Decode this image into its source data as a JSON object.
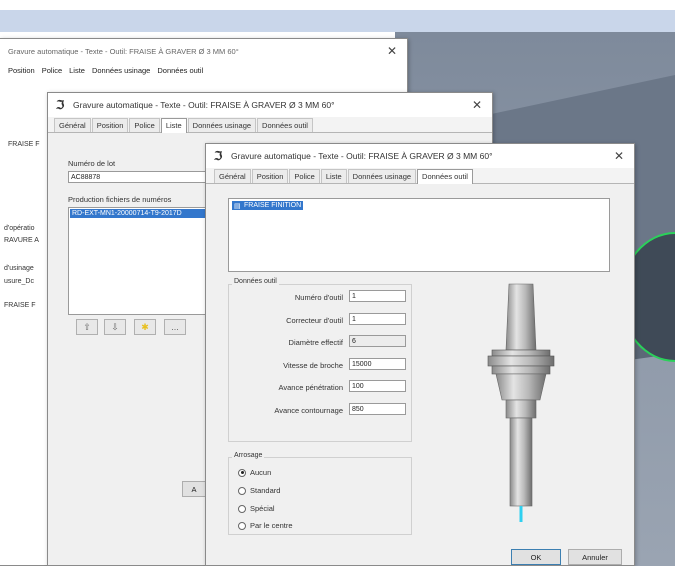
{
  "win1": {
    "title": "Gravure automatique - Texte - Outil: FRAISE À GRAVER Ø 3 MM 60°",
    "tabs": [
      "Position",
      "Police",
      "Liste",
      "Données usinage",
      "Données outil"
    ],
    "side_labels": [
      "FRAISE F",
      "d'opératio",
      "RAVURE A",
      "d'usinage",
      "usure_Dc",
      "FRAISE F"
    ],
    "bottom_button": "A"
  },
  "win2": {
    "title": "Gravure automatique - Texte - Outil: FRAISE À GRAVER Ø 3 MM 60°",
    "tabs": [
      "Général",
      "Position",
      "Police",
      "Liste",
      "Données usinage",
      "Données outil"
    ],
    "active_tab": 3,
    "lot_label": "Numéro de lot",
    "lot_value": "AC88878",
    "file_label": "Production fichiers de numéros",
    "file_item": "RD-EXT-MN1-20000714-T9-2017D",
    "icons": [
      "arrow-up-icon",
      "arrow-down-icon",
      "star-icon",
      "ellipsis-icon"
    ],
    "ellipsis": "..."
  },
  "win3": {
    "title": "Gravure automatique - Texte - Outil: FRAISE À GRAVER Ø 3 MM 60°",
    "tabs": [
      "Général",
      "Position",
      "Police",
      "Liste",
      "Données usinage",
      "Données outil"
    ],
    "active_tab": 5,
    "tool_list_item": "FRAISE FINITION",
    "group_tool": {
      "title": "Données outil",
      "fields": [
        {
          "label": "Numéro d'outil",
          "value": "1",
          "readonly": false
        },
        {
          "label": "Correcteur d'outil",
          "value": "1",
          "readonly": false
        },
        {
          "label": "Diamètre effectif",
          "value": "6",
          "readonly": true
        },
        {
          "label": "Vitesse de broche",
          "value": "15000",
          "readonly": false
        },
        {
          "label": "Avance pénétration",
          "value": "100",
          "readonly": false
        },
        {
          "label": "Avance contournage",
          "value": "850",
          "readonly": false
        }
      ]
    },
    "group_arrosage": {
      "title": "Arrosage",
      "options": [
        "Aucun",
        "Standard",
        "Spécial",
        "Par le centre"
      ],
      "selected": 0
    },
    "ok_label": "OK",
    "cancel_label": "Annuler"
  },
  "colors": {
    "selection": "#3377cc",
    "viewport_top": "#c9d6ea",
    "viewport_scene": "#8d98a8",
    "accent_green": "#2bd15a",
    "coolant": "#2fd0f0"
  }
}
